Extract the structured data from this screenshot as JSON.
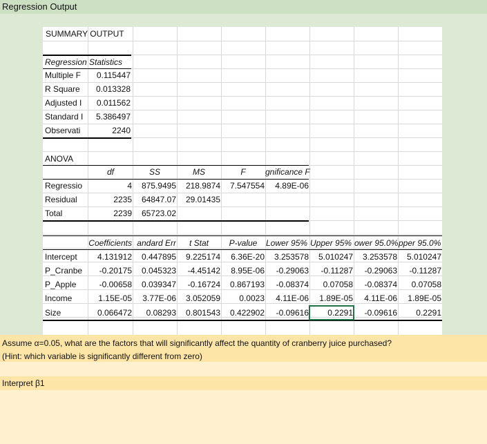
{
  "sheet_title": "Regression Output",
  "summary_title": "SUMMARY OUTPUT",
  "reg_stats": {
    "header": "Regression Statistics",
    "rows": [
      {
        "label": "Multiple F",
        "value": "0.115447"
      },
      {
        "label": "R Square",
        "value": "0.013328"
      },
      {
        "label": "Adjusted I",
        "value": "0.011562"
      },
      {
        "label": "Standard I",
        "value": "5.386497"
      },
      {
        "label": "Observati",
        "value": "2240"
      }
    ]
  },
  "anova": {
    "title": "ANOVA",
    "headers": [
      "df",
      "SS",
      "MS",
      "F",
      "gnificance F"
    ],
    "rows": [
      {
        "label": "Regressio",
        "cells": [
          "4",
          "875.9495",
          "218.9874",
          "7.547554",
          "4.89E-06"
        ]
      },
      {
        "label": "Residual",
        "cells": [
          "2235",
          "64847.07",
          "29.01435",
          "",
          ""
        ]
      },
      {
        "label": "Total",
        "cells": [
          "2239",
          "65723.02",
          "",
          "",
          ""
        ]
      }
    ]
  },
  "coef": {
    "headers": [
      "Coefficients",
      "andard Err",
      "t Stat",
      "P-value",
      "Lower 95%",
      "Upper 95%",
      "ower 95.0%",
      "pper 95.0%"
    ],
    "rows": [
      {
        "label": "Intercept",
        "cells": [
          "4.131912",
          "0.447895",
          "9.225174",
          "6.36E-20",
          "3.253578",
          "5.010247",
          "3.253578",
          "5.010247"
        ]
      },
      {
        "label": "P_Cranbe",
        "cells": [
          "-0.20175",
          "0.045323",
          "-4.45142",
          "8.95E-06",
          "-0.29063",
          "-0.11287",
          "-0.29063",
          "-0.11287"
        ]
      },
      {
        "label": "P_Apple",
        "cells": [
          "-0.00658",
          "0.039347",
          "-0.16724",
          "0.867193",
          "-0.08374",
          "0.07058",
          "-0.08374",
          "0.07058"
        ]
      },
      {
        "label": "Income",
        "cells": [
          "1.15E-05",
          "3.77E-06",
          "3.052059",
          "0.0023",
          "4.11E-06",
          "1.89E-05",
          "4.11E-06",
          "1.89E-05"
        ]
      },
      {
        "label": "Size",
        "cells": [
          "0.066472",
          "0.08293",
          "0.801543",
          "0.422902",
          "-0.09616",
          "0.2291",
          "-0.09616",
          "0.2291"
        ]
      }
    ]
  },
  "question1": {
    "line1": "Assume α=0.05, what are the factors that will significantly affect the quantity of cranberry juice purchased?",
    "line2": "(Hint: which variable is significantly different from zero)"
  },
  "question2": "Interpret β1",
  "colors": {
    "header_green": "#cde0c3",
    "bg_green": "#dde9d4",
    "band_yellow": "#fde5a7",
    "band_cream": "#fff0cf",
    "selection": "#217346"
  }
}
